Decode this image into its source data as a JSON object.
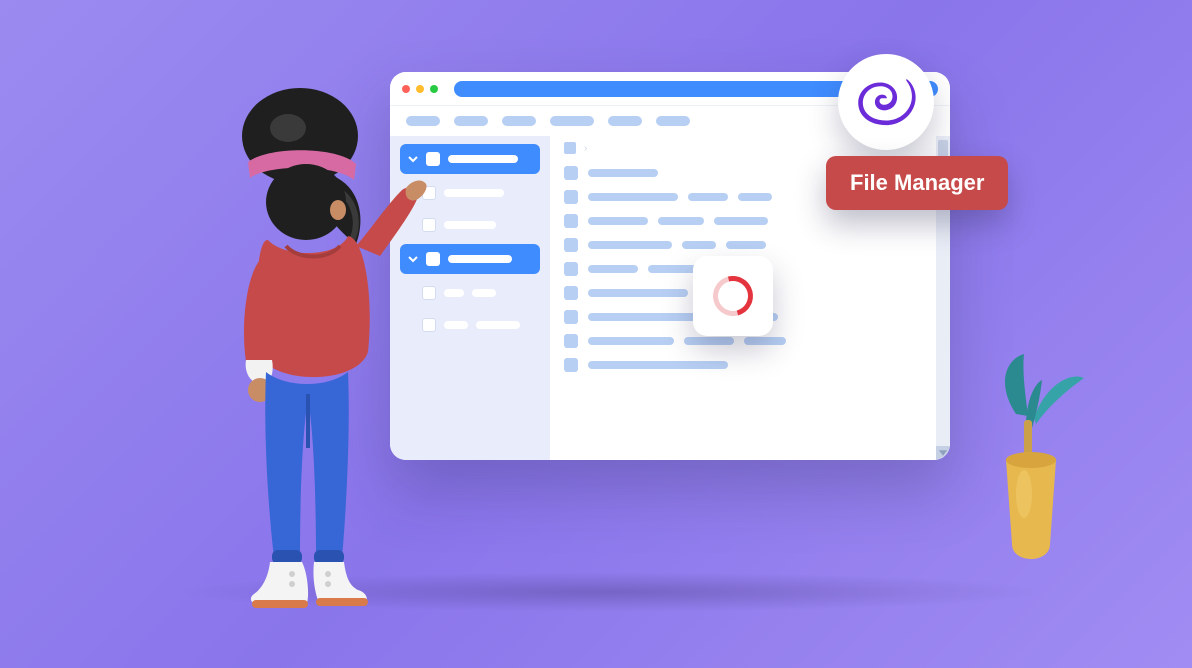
{
  "window": {
    "traffic_lights": [
      "close",
      "minimize",
      "zoom"
    ],
    "toolbar_items": [
      34,
      34,
      34,
      44,
      34,
      34
    ],
    "breadcrumb_separator": "›"
  },
  "sidebar": {
    "groups": [
      {
        "expanded": true,
        "label_width": 70,
        "items": [
          {
            "label_width": 60
          },
          {
            "label_width": 52
          }
        ]
      },
      {
        "expanded": true,
        "label_width": 64,
        "items": [
          {
            "label_width": 20,
            "second": 24
          },
          {
            "label_width": 24,
            "second": 44
          }
        ]
      }
    ]
  },
  "files": {
    "rows": [
      {
        "cols": [
          70
        ]
      },
      {
        "cols": [
          90,
          40,
          34
        ]
      },
      {
        "cols": [
          60,
          46,
          54
        ]
      },
      {
        "cols": [
          84,
          34,
          40
        ]
      },
      {
        "cols": [
          50,
          60,
          30
        ]
      },
      {
        "cols": [
          100,
          40
        ]
      },
      {
        "cols": [
          120,
          60
        ]
      },
      {
        "cols": [
          86,
          50,
          42
        ]
      },
      {
        "cols": [
          140
        ]
      }
    ]
  },
  "label_tag": "File Manager",
  "badge_icon": "blazor-logo",
  "loading_icon": "spinner"
}
